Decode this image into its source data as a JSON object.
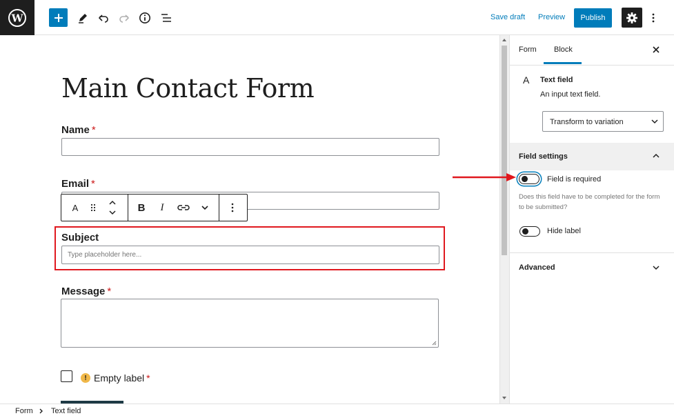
{
  "toolbar": {
    "save_draft": "Save draft",
    "preview": "Preview",
    "publish": "Publish"
  },
  "icons": {
    "logo": "wordpress-logo-icon",
    "add": "plus-icon",
    "tools": "pencil-icon",
    "undo": "undo-icon",
    "redo": "redo-icon",
    "details": "info-icon",
    "outline": "list-view-icon",
    "settings": "gear-icon",
    "options": "vertical-ellipsis-icon"
  },
  "form": {
    "title": "Main Contact Form",
    "required_mark": "*",
    "fields": {
      "name": {
        "label": "Name"
      },
      "email": {
        "label": "Email"
      },
      "subject": {
        "label": "Subject",
        "placeholder": "Type placeholder here..."
      },
      "message": {
        "label": "Message"
      },
      "checkbox": {
        "label": "Empty label"
      }
    },
    "block_toolbar": {
      "type_icon": "A",
      "bold": "B",
      "italic": "I"
    }
  },
  "sidebar": {
    "tabs": [
      "Form",
      "Block"
    ],
    "active_tab": "Block",
    "block": {
      "icon": "A",
      "name": "Text field",
      "description": "An input text field.",
      "transform_label": "Transform to variation"
    },
    "field_settings": {
      "heading": "Field settings",
      "required_label": "Field is required",
      "required_on": false,
      "required_help": "Does this field have to be completed for the form to be submitted?",
      "hide_label": "Hide label",
      "hide_on": false
    },
    "advanced": "Advanced"
  },
  "breadcrumb": [
    "Form",
    "Text field"
  ],
  "colors": {
    "accent": "#007cba",
    "highlight": "#e0171d",
    "required": "#cc1818",
    "dark": "#1e1e1e"
  }
}
